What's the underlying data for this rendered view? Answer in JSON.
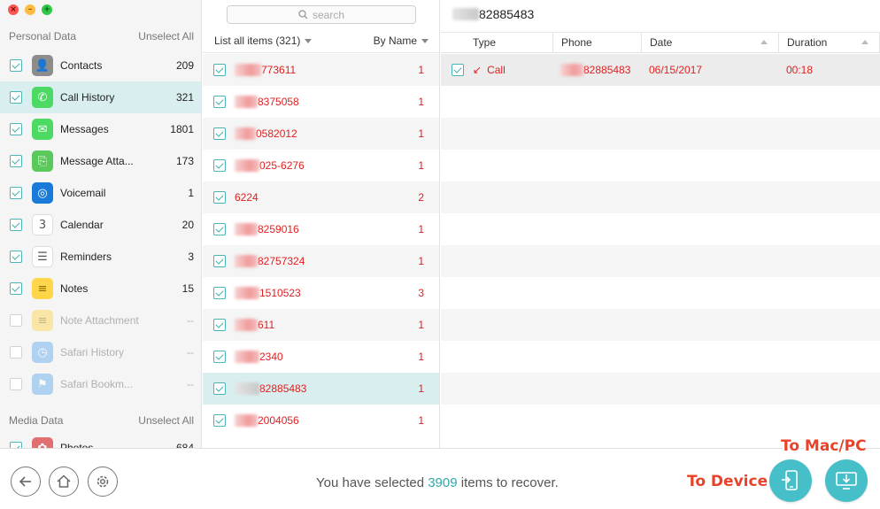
{
  "window": {
    "controls": [
      "close",
      "minimize",
      "maximize"
    ]
  },
  "sidebar": {
    "personal_header": "Personal Data",
    "personal_action": "Unselect All",
    "personal_items": [
      {
        "label": "Contacts",
        "count": "209",
        "checked": true,
        "icon": "contacts-icon",
        "color": "#8c8c8c"
      },
      {
        "label": "Call History",
        "count": "321",
        "checked": true,
        "icon": "phone-icon",
        "color": "#4cd964",
        "selected": true
      },
      {
        "label": "Messages",
        "count": "1801",
        "checked": true,
        "icon": "messages-icon",
        "color": "#4cd964"
      },
      {
        "label": "Message Atta...",
        "count": "173",
        "checked": true,
        "icon": "message-attachment-icon",
        "color": "#5ac85a"
      },
      {
        "label": "Voicemail",
        "count": "1",
        "checked": true,
        "icon": "voicemail-icon",
        "color": "#1a7ad9"
      },
      {
        "label": "Calendar",
        "count": "20",
        "checked": true,
        "icon": "calendar-icon",
        "color": "#ffffff"
      },
      {
        "label": "Reminders",
        "count": "3",
        "checked": true,
        "icon": "reminders-icon",
        "color": "#ffffff"
      },
      {
        "label": "Notes",
        "count": "15",
        "checked": true,
        "icon": "notes-icon",
        "color": "#ffd54a"
      },
      {
        "label": "Note Attachment",
        "count": "--",
        "checked": false,
        "icon": "note-attachment-icon",
        "color": "#ffd54a"
      },
      {
        "label": "Safari History",
        "count": "--",
        "checked": false,
        "icon": "safari-history-icon",
        "color": "#5aa8e8"
      },
      {
        "label": "Safari Bookm...",
        "count": "--",
        "checked": false,
        "icon": "safari-bookmark-icon",
        "color": "#5aa8e8"
      }
    ],
    "media_header": "Media Data",
    "media_action": "Unselect All",
    "media_items": [
      {
        "label": "Photos",
        "count": "684",
        "checked": true,
        "icon": "photos-icon"
      }
    ]
  },
  "list": {
    "search_placeholder": "search",
    "header_left": "List all items (321)",
    "header_right": "By Name",
    "rows": [
      {
        "number": "773611",
        "count": "1",
        "blur": 30
      },
      {
        "number": "8375058",
        "count": "1",
        "blur": 26
      },
      {
        "number": "0582012",
        "count": "1",
        "blur": 24
      },
      {
        "number": "025-6276",
        "count": "1",
        "blur": 28
      },
      {
        "number": "6224",
        "count": "2",
        "blur": 0
      },
      {
        "number": "8259016",
        "count": "1",
        "blur": 26
      },
      {
        "number": "82757324",
        "count": "1",
        "blur": 26
      },
      {
        "number": "1510523",
        "count": "3",
        "blur": 28
      },
      {
        "number": "611",
        "count": "1",
        "blur": 26
      },
      {
        "number": "2340",
        "count": "1",
        "blur": 28
      },
      {
        "number": "82885483",
        "count": "1",
        "blur": 28,
        "selected": true
      },
      {
        "number": "2004056",
        "count": "1",
        "blur": 26
      }
    ]
  },
  "detail": {
    "title": "82885483",
    "columns": [
      "Type",
      "Phone",
      "Date",
      "Duration"
    ],
    "rows": [
      {
        "type": "Call",
        "phone": "82885483",
        "date": "06/15/2017",
        "duration": "00:18"
      }
    ]
  },
  "footer": {
    "status_prefix": "You have selected ",
    "status_count": "3909",
    "status_suffix": " items to recover.",
    "to_device_label": "To Device",
    "to_mac_label": "To Mac/PC"
  },
  "colors": {
    "accent": "#47bfc9",
    "selected_row": "#d9efef",
    "record_text": "#e02020",
    "overlay_label": "#e8432a"
  }
}
